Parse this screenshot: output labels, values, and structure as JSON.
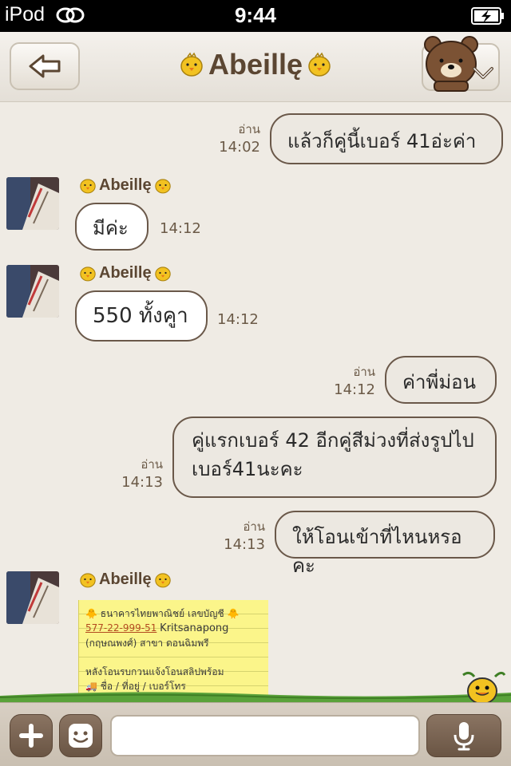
{
  "status_bar": {
    "carrier": "iPod",
    "time": "9:44",
    "wifi_icon": "link-icon",
    "battery_icon": "battery-charging-icon"
  },
  "nav": {
    "title": "Abeillę",
    "back_icon": "back-arrow-icon",
    "menu_icon": "chevron-down-icon"
  },
  "messages": [
    {
      "dir": "out",
      "text": "แล้วก็คู่นี้เบอร์ 41อ่ะค่า",
      "read": "อ่าน",
      "time": "14:02"
    },
    {
      "dir": "in",
      "sender": "Abeillę",
      "text": "มีค่ะ",
      "time": "14:12"
    },
    {
      "dir": "in",
      "sender": "Abeillę",
      "text": "550 ทั้งคูา",
      "time": "14:12"
    },
    {
      "dir": "out",
      "text": "ค่าพี่ม่อน",
      "read": "อ่าน",
      "time": "14:12"
    },
    {
      "dir": "out",
      "text": "คู่แรกเบอร์ 42 อีกคู่สีม่วงที่ส่งรูปไป เบอร์41นะคะ",
      "read": "อ่าน",
      "time": "14:13"
    },
    {
      "dir": "out",
      "text": "ให้โอนเข้าที่ไหนหรอคะ",
      "read": "อ่าน",
      "time": "14:13"
    },
    {
      "dir": "in",
      "sender": "Abeillę",
      "type": "image"
    }
  ],
  "note": {
    "line1": "ธนาคารไทยพาณิชย์ เลขบัญชี",
    "account": "577-22-999-51",
    "name": "Kritsanapong",
    "line3": "(กฤษณพงศ์)  สาขา ดอนฉิมพรี",
    "line4": "หลังโอนรบกวนแจ้งโอนสลิปพร้อม",
    "line5": "ชื่อ / ที่อยู่ / เบอร์โทร"
  },
  "input_bar": {
    "add_icon": "plus-icon",
    "sticker_icon": "smiley-icon",
    "mic_icon": "microphone-icon"
  },
  "colors": {
    "accent_brown": "#6a5544",
    "bubble_border": "#6a5849",
    "title": "#5b4632"
  }
}
